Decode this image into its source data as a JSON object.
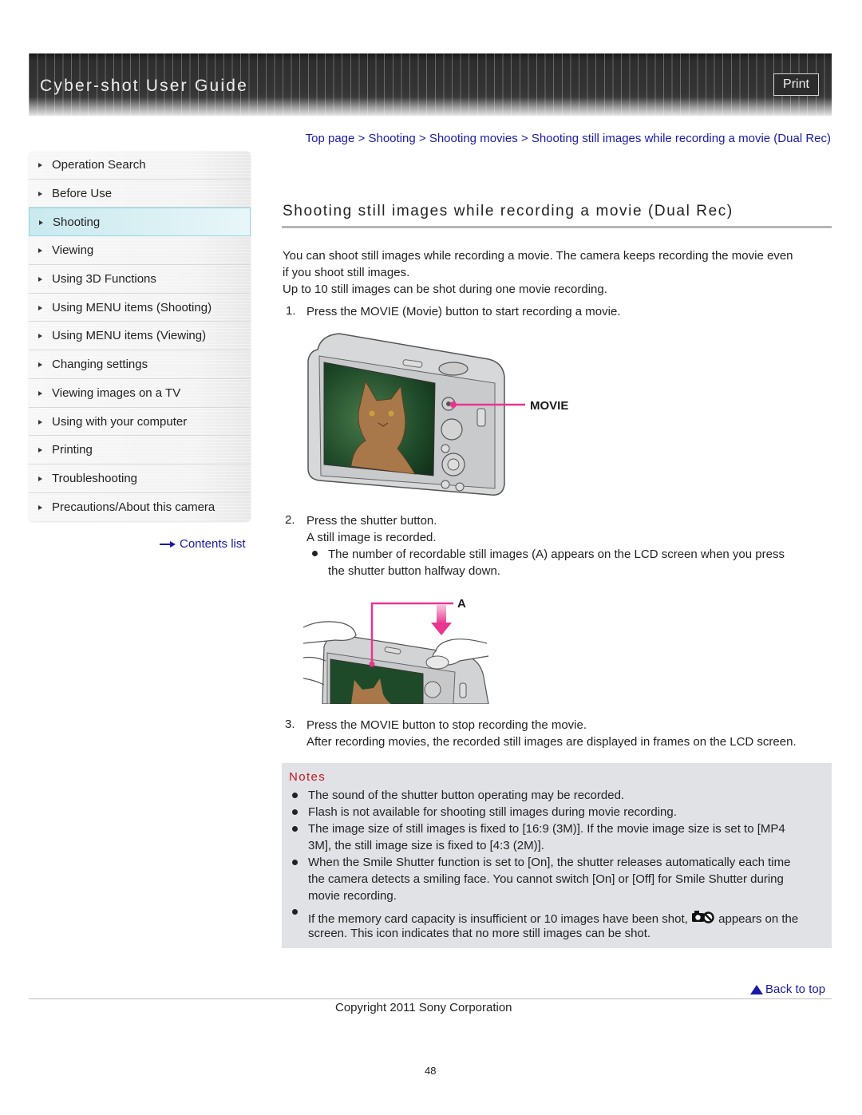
{
  "header": {
    "title": "Cyber-shot User Guide",
    "print_label": "Print"
  },
  "sidebar": {
    "items": [
      {
        "label": "Operation Search",
        "active": false
      },
      {
        "label": "Before Use",
        "active": false
      },
      {
        "label": "Shooting",
        "active": true
      },
      {
        "label": "Viewing",
        "active": false
      },
      {
        "label": "Using 3D Functions",
        "active": false
      },
      {
        "label": "Using MENU items (Shooting)",
        "active": false
      },
      {
        "label": "Using MENU items (Viewing)",
        "active": false
      },
      {
        "label": "Changing settings",
        "active": false
      },
      {
        "label": "Viewing images on a TV",
        "active": false
      },
      {
        "label": "Using with your computer",
        "active": false
      },
      {
        "label": "Printing",
        "active": false
      },
      {
        "label": "Troubleshooting",
        "active": false
      },
      {
        "label": "Precautions/About this camera",
        "active": false
      }
    ],
    "contents_link": "Contents list"
  },
  "breadcrumb": {
    "items": [
      "Top page",
      "Shooting",
      "Shooting movies",
      "Shooting still images while recording a movie (Dual Rec)"
    ],
    "separator": " > "
  },
  "main": {
    "title": "Shooting still images while recording a movie (Dual Rec)",
    "intro_line1": "You can shoot still images while recording a movie. The camera keeps recording the movie even",
    "intro_line2": "if you shoot still images.",
    "intro_line3": "Up to 10 still images can be shot during one movie recording.",
    "steps": [
      {
        "num": "1.",
        "text": "Press the MOVIE (Movie) button to start recording a movie.",
        "figure_label": "MOVIE"
      },
      {
        "num": "2.",
        "text": "Press the shutter button.",
        "subtext": "A still image is recorded.",
        "bullet_line1": "The number of recordable still images (A) appears on the LCD screen when you press",
        "bullet_line2": "the shutter button halfway down.",
        "figure_label": "A"
      },
      {
        "num": "3.",
        "text": "Press the MOVIE button to stop recording the movie.",
        "subtext": "After recording movies, the recorded still images are displayed in frames on the LCD screen."
      }
    ]
  },
  "notes": {
    "title": "Notes",
    "items": [
      {
        "lines": [
          "The sound of the shutter button operating may be recorded."
        ]
      },
      {
        "lines": [
          "Flash is not available for shooting still images during movie recording."
        ]
      },
      {
        "lines": [
          "The image size of still images is fixed to [16:9 (3M)]. If the movie image size is set to [MP4",
          "3M], the still image size is fixed to [4:3 (2M)]."
        ]
      },
      {
        "lines": [
          "When the Smile Shutter function is set to [On], the shutter releases automatically each time",
          "the camera detects a smiling face. You cannot switch [On] or [Off] for Smile Shutter during",
          "movie recording."
        ]
      },
      {
        "lines": [
          "If the memory card capacity is insufficient or 10 images have been shot,",
          "appears on the",
          "screen. This icon indicates that no more still images can be shot."
        ],
        "icon": "no-still-image-icon"
      }
    ]
  },
  "footer": {
    "back_to_top": "Back to top",
    "copyright": "Copyright 2011 Sony Corporation",
    "page_number": "48"
  },
  "colors": {
    "link": "#1a1aa6",
    "notes_title": "#c4151c",
    "notes_bg": "#e1e2e6",
    "accent_magenta": "#e8358f",
    "active_nav": "#c9eaf0"
  }
}
